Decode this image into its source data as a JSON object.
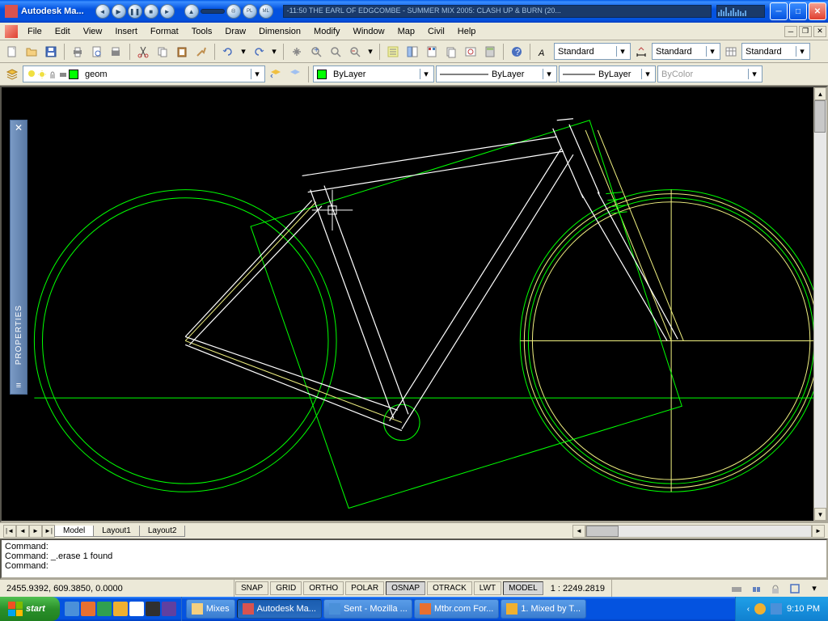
{
  "titlebar": {
    "app_title": "Autodesk Ma...",
    "track_info": "-11:50  THE EARL OF EDGCOMBE - SUMMER MIX 2005: CLASH UP & BURN (20..."
  },
  "menu": {
    "items": [
      "File",
      "Edit",
      "View",
      "Insert",
      "Format",
      "Tools",
      "Draw",
      "Dimension",
      "Modify",
      "Window",
      "Map",
      "Civil",
      "Help"
    ]
  },
  "toolbar1": {
    "text_style": "Standard",
    "dim_style": "Standard",
    "table_style": "Standard"
  },
  "toolbar2": {
    "layer_name": "geom",
    "color": "ByLayer",
    "linetype": "ByLayer",
    "lineweight": "ByLayer",
    "plot_style": "ByColor"
  },
  "properties": {
    "label": "PROPERTIES"
  },
  "tabs": {
    "model": "Model",
    "layout1": "Layout1",
    "layout2": "Layout2"
  },
  "command": {
    "line1": "Command:",
    "line2": "Command: _.erase 1 found",
    "line3": "Command:"
  },
  "status": {
    "coords": "2455.9392, 609.3850, 0.0000",
    "snap": "SNAP",
    "grid": "GRID",
    "ortho": "ORTHO",
    "polar": "POLAR",
    "osnap": "OSNAP",
    "otrack": "OTRACK",
    "lwt": "LWT",
    "model": "MODEL",
    "scale": "1 : 2249.2819"
  },
  "taskbar": {
    "start": "start",
    "tasks": [
      {
        "label": "Mixes",
        "color": "#f5d080"
      },
      {
        "label": "Autodesk Ma...",
        "color": "#d9534f",
        "active": true
      },
      {
        "label": "Sent - Mozilla ...",
        "color": "#4a90d9"
      },
      {
        "label": "Mtbr.com For...",
        "color": "#e87030"
      },
      {
        "label": "1. Mixed by T...",
        "color": "#f0b030"
      }
    ],
    "time": "9:10 PM"
  }
}
